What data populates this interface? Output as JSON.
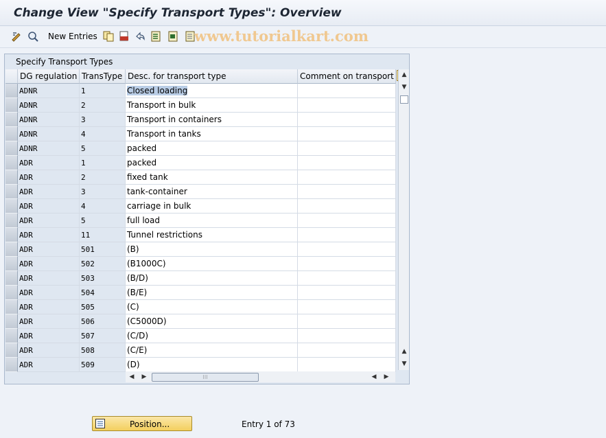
{
  "title": "Change View \"Specify Transport Types\": Overview",
  "toolbar": {
    "new_entries_label": "New Entries",
    "icons": [
      "display-change-icon",
      "other-view-icon",
      "copy-icon",
      "delete-icon",
      "undo-icon",
      "select-all-icon",
      "select-block-icon",
      "deselect-all-icon"
    ]
  },
  "watermark": "www.tutorialkart.com",
  "panel": {
    "title": "Specify Transport Types",
    "columns": [
      "DG regulation",
      "TransType",
      "Desc. for transport type",
      "Comment on transport ty"
    ]
  },
  "rows": [
    {
      "dg": "ADNR",
      "tt": "1",
      "desc": "Closed loading",
      "comment": ""
    },
    {
      "dg": "ADNR",
      "tt": "2",
      "desc": "Transport in bulk",
      "comment": ""
    },
    {
      "dg": "ADNR",
      "tt": "3",
      "desc": "Transport in containers",
      "comment": ""
    },
    {
      "dg": "ADNR",
      "tt": "4",
      "desc": "Transport in tanks",
      "comment": ""
    },
    {
      "dg": "ADNR",
      "tt": "5",
      "desc": "packed",
      "comment": ""
    },
    {
      "dg": "ADR",
      "tt": "1",
      "desc": "packed",
      "comment": ""
    },
    {
      "dg": "ADR",
      "tt": "2",
      "desc": "fixed tank",
      "comment": ""
    },
    {
      "dg": "ADR",
      "tt": "3",
      "desc": "tank-container",
      "comment": ""
    },
    {
      "dg": "ADR",
      "tt": "4",
      "desc": "carriage in bulk",
      "comment": ""
    },
    {
      "dg": "ADR",
      "tt": "5",
      "desc": "full load",
      "comment": ""
    },
    {
      "dg": "ADR",
      "tt": "11",
      "desc": "Tunnel restrictions",
      "comment": ""
    },
    {
      "dg": "ADR",
      "tt": "501",
      "desc": "(B)",
      "comment": ""
    },
    {
      "dg": "ADR",
      "tt": "502",
      "desc": "(B1000C)",
      "comment": ""
    },
    {
      "dg": "ADR",
      "tt": "503",
      "desc": "(B/D)",
      "comment": ""
    },
    {
      "dg": "ADR",
      "tt": "504",
      "desc": "(B/E)",
      "comment": ""
    },
    {
      "dg": "ADR",
      "tt": "505",
      "desc": "(C)",
      "comment": ""
    },
    {
      "dg": "ADR",
      "tt": "506",
      "desc": "(C5000D)",
      "comment": ""
    },
    {
      "dg": "ADR",
      "tt": "507",
      "desc": "(C/D)",
      "comment": ""
    },
    {
      "dg": "ADR",
      "tt": "508",
      "desc": "(C/E)",
      "comment": ""
    },
    {
      "dg": "ADR",
      "tt": "509",
      "desc": "(D)",
      "comment": ""
    }
  ],
  "footer": {
    "position_label": "Position...",
    "entry_text": "Entry 1 of 73"
  }
}
